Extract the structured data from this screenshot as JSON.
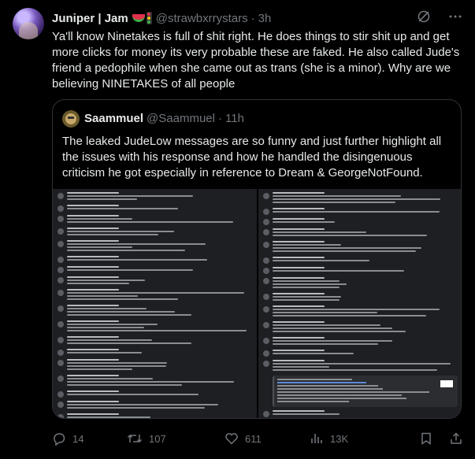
{
  "tweet": {
    "author": {
      "name": "Juniper | Jam",
      "handle": "@strawbxrrystars",
      "emoji": [
        "watermelon-emoji",
        "traffic-light-emoji"
      ]
    },
    "time": "3h",
    "separator": "·",
    "text": "Ya'll know Ninetakes is full of shit right. He does things to stir shit up and get more clicks for money its very probable these are faked. He also called Jude's friend a pedophile when she came out as trans (she is a minor). Why are we believing NINETAKES of all people"
  },
  "quote": {
    "author": {
      "name": "Saammuel",
      "handle": "@Saammuel"
    },
    "separator": "·",
    "time": "11h",
    "text": "The leaked JudeLow messages are so funny and just further highlight all the issues with his response and how he handled the disingenuous criticism he got especially in reference to Dream & GeorgeNotFound."
  },
  "actions": {
    "replies": "14",
    "retweets": "107",
    "likes": "611",
    "views": "13K"
  },
  "icons": {
    "grok": "grok-icon",
    "more": "more-icon",
    "reply": "reply-icon",
    "retweet": "retweet-icon",
    "like": "heart-icon",
    "views": "views-icon",
    "bookmark": "bookmark-icon",
    "share": "share-icon"
  },
  "colors": {
    "background": "#000000",
    "text": "#e7e9ea",
    "muted": "#71767b",
    "border": "#2f3336"
  }
}
